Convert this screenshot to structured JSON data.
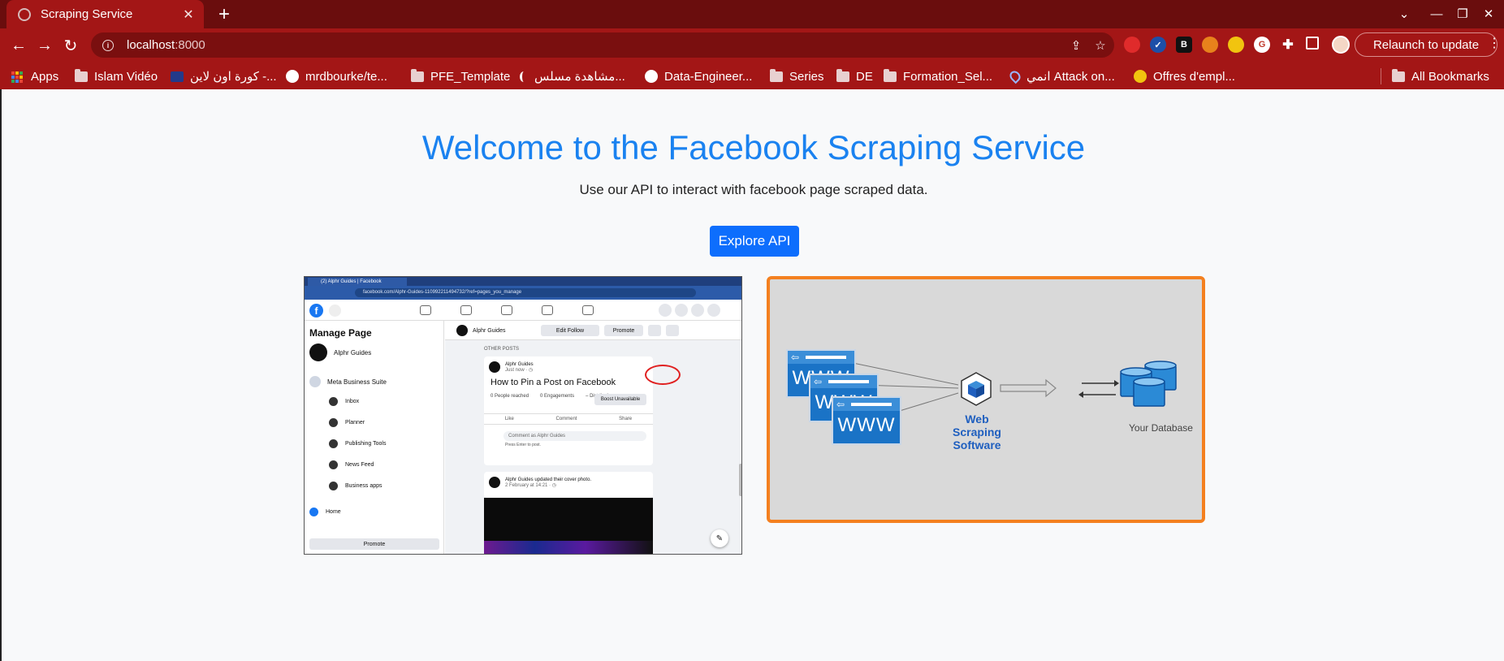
{
  "browser": {
    "tab_title": "Scraping Service",
    "tab_close": "✕",
    "new_tab": "+",
    "url_host": "localhost",
    "url_port": ":8000",
    "relaunch_label": "Relaunch to update",
    "window_controls": {
      "dropdown": "⌄",
      "minimize": "—",
      "restore": "❐",
      "close": "✕"
    },
    "nav": {
      "back": "←",
      "forward": "→",
      "reload": "↻"
    },
    "omnibox_actions": {
      "share": "⇪",
      "bookmark": "☆"
    },
    "extensions": [
      "stop-ext",
      "check-ext",
      "b-ext",
      "fox-ext",
      "target-ext",
      "g-ext",
      "puzzle-ext",
      "sidepanel-ext"
    ]
  },
  "bookmarks": {
    "items": [
      {
        "label": "Apps",
        "icon": "apps-grid-icon"
      },
      {
        "label": "Islam Vidéo",
        "icon": "folder-icon"
      },
      {
        "label": "كورة اون لاين -...",
        "icon": "site-icon"
      },
      {
        "label": "mrdbourke/te...",
        "icon": "github-icon"
      },
      {
        "label": "PFE_Template",
        "icon": "folder-icon"
      },
      {
        "label": "مشاهدة مسلس...",
        "icon": "moon-icon"
      },
      {
        "label": "Data-Engineer...",
        "icon": "github-icon"
      },
      {
        "label": "Series",
        "icon": "folder-icon"
      },
      {
        "label": "DE",
        "icon": "folder-icon"
      },
      {
        "label": "Formation_Sel...",
        "icon": "folder-icon"
      },
      {
        "label": "انمي Attack on...",
        "icon": "pin-icon"
      },
      {
        "label": "Offres d'empl...",
        "icon": "badge-icon"
      }
    ],
    "all_bookmarks": "All Bookmarks"
  },
  "page": {
    "headline": "Welcome to the Facebook Scraping Service",
    "subtitle": "Use our API to interact with facebook page scraped data.",
    "explore_button": "Explore API"
  },
  "facebook_shot": {
    "tab_title": "(2) Alphr Guides | Facebook",
    "url": "facebook.com/Alphr-Guides-110992211494732/?ref=pages_you_manage",
    "manage_page": "Manage Page",
    "account": "Alphr Guides",
    "meta_suite": "Meta Business Suite",
    "side_items": [
      "Inbox",
      "Planner",
      "Publishing Tools",
      "News Feed",
      "Business apps"
    ],
    "home": "Home",
    "promote": "Promote",
    "page_name": "Alphr Guides",
    "edit_follow": "Edit Follow",
    "promote_top": "Promote",
    "other_posts": "OTHER POSTS",
    "post1_author": "Alphr Guides",
    "post1_time": "Just now · ◷",
    "post1_title": "How to Pin a Post on Facebook",
    "stats": [
      "0 People reached",
      "0 Engagements",
      "– Distribution score"
    ],
    "boost": "Boost Unavailable",
    "actions": [
      "Like",
      "Comment",
      "Share"
    ],
    "comment_placeholder": "Comment as Alphr Guides",
    "press_enter": "Press Enter to post.",
    "post2_author": "Alphr Guides updated their cover photo.",
    "post2_time": "2 February at 14:21 · ◷"
  },
  "diagram": {
    "www_label": "WWW",
    "software_line1": "Web Scraping",
    "software_line2": "Software",
    "db_label": "Your Database"
  }
}
